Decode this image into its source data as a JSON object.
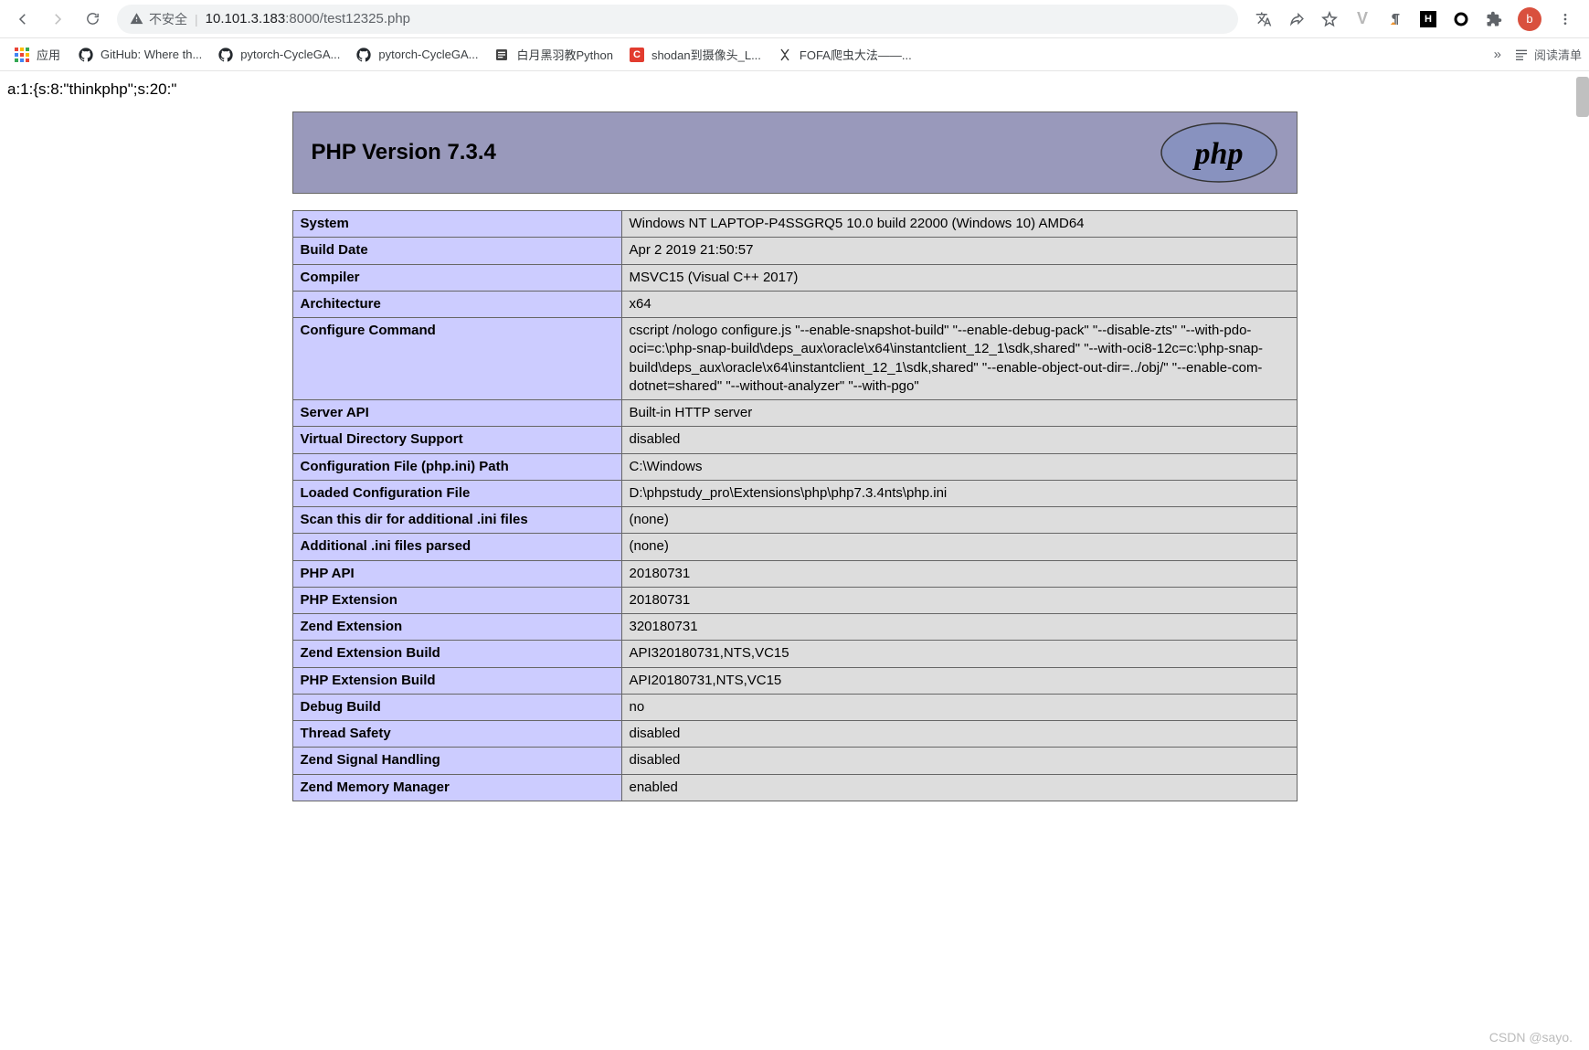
{
  "browser": {
    "insecure_label": "不安全",
    "url_display_host": "10.101.3.183",
    "url_display_port_path": ":8000/test12325.php",
    "avatar_letter": "b"
  },
  "bookmarks": {
    "apps_label": "应用",
    "items": [
      {
        "label": "GitHub: Where th...",
        "icon": "github"
      },
      {
        "label": "pytorch-CycleGA...",
        "icon": "github"
      },
      {
        "label": "pytorch-CycleGA...",
        "icon": "github"
      },
      {
        "label": "白月黑羽教Python",
        "icon": "doc"
      },
      {
        "label": "shodan到摄像头_L...",
        "icon": "c-red"
      },
      {
        "label": "FOFA爬虫大法——...",
        "icon": "fofa"
      }
    ],
    "more_glyph": "»",
    "reading_list_label": "阅读清单"
  },
  "page": {
    "raw_preamble": "a:1:{s:8:\"thinkphp\";s:20:\"",
    "php_version_title": "PHP Version 7.3.4",
    "rows": [
      {
        "k": "System",
        "v": "Windows NT LAPTOP-P4SSGRQ5 10.0 build 22000 (Windows 10) AMD64"
      },
      {
        "k": "Build Date",
        "v": "Apr 2 2019 21:50:57"
      },
      {
        "k": "Compiler",
        "v": "MSVC15 (Visual C++ 2017)"
      },
      {
        "k": "Architecture",
        "v": "x64"
      },
      {
        "k": "Configure Command",
        "v": "cscript /nologo configure.js \"--enable-snapshot-build\" \"--enable-debug-pack\" \"--disable-zts\" \"--with-pdo-oci=c:\\php-snap-build\\deps_aux\\oracle\\x64\\instantclient_12_1\\sdk,shared\" \"--with-oci8-12c=c:\\php-snap-build\\deps_aux\\oracle\\x64\\instantclient_12_1\\sdk,shared\" \"--enable-object-out-dir=../obj/\" \"--enable-com-dotnet=shared\" \"--without-analyzer\" \"--with-pgo\""
      },
      {
        "k": "Server API",
        "v": "Built-in HTTP server"
      },
      {
        "k": "Virtual Directory Support",
        "v": "disabled"
      },
      {
        "k": "Configuration File (php.ini) Path",
        "v": "C:\\Windows"
      },
      {
        "k": "Loaded Configuration File",
        "v": "D:\\phpstudy_pro\\Extensions\\php\\php7.3.4nts\\php.ini"
      },
      {
        "k": "Scan this dir for additional .ini files",
        "v": "(none)"
      },
      {
        "k": "Additional .ini files parsed",
        "v": "(none)"
      },
      {
        "k": "PHP API",
        "v": "20180731"
      },
      {
        "k": "PHP Extension",
        "v": "20180731"
      },
      {
        "k": "Zend Extension",
        "v": "320180731"
      },
      {
        "k": "Zend Extension Build",
        "v": "API320180731,NTS,VC15"
      },
      {
        "k": "PHP Extension Build",
        "v": "API20180731,NTS,VC15"
      },
      {
        "k": "Debug Build",
        "v": "no"
      },
      {
        "k": "Thread Safety",
        "v": "disabled"
      },
      {
        "k": "Zend Signal Handling",
        "v": "disabled"
      },
      {
        "k": "Zend Memory Manager",
        "v": "enabled"
      }
    ]
  },
  "watermark": "CSDN @sayo."
}
